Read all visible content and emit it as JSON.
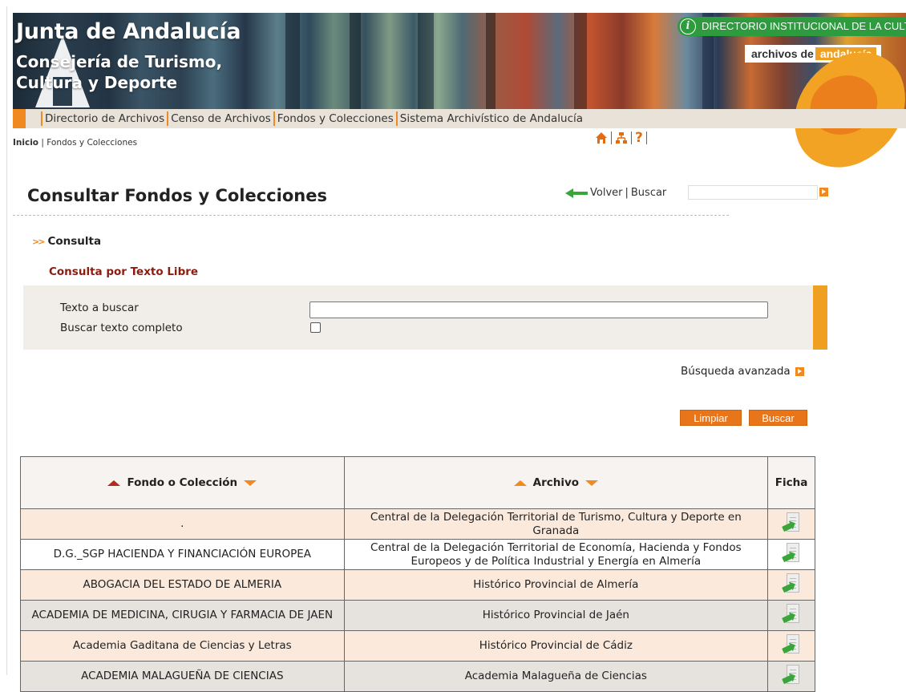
{
  "banner": {
    "title": "Junta de Andalucía",
    "subtitle_line1": "Consejería de Turismo,",
    "subtitle_line2": "Cultura y Deporte",
    "directory_link": "DIRECTORIO INSTITUCIONAL DE LA CULTURA",
    "brand_prefix": "archivos de",
    "brand_highlight": "andalucía"
  },
  "menu": {
    "items": [
      "Directorio de Archivos",
      "Censo de Archivos",
      "Fondos y Colecciones",
      "Sistema Archivístico de Andalucía"
    ]
  },
  "breadcrumb": {
    "home": "Inicio",
    "separator": "|",
    "current": "Fondos y Colecciones"
  },
  "util": {
    "help_label": "?"
  },
  "header": {
    "title": "Consultar Fondos y Colecciones",
    "back_label": "Volver",
    "separator": "|",
    "search_label": "Buscar",
    "search_value": ""
  },
  "section": {
    "title": "Consulta",
    "subtitle": "Consulta por Texto Libre"
  },
  "form": {
    "text_label": "Texto a buscar",
    "text_value": "",
    "full_text_label": "Buscar texto completo",
    "full_text_checked": false
  },
  "advanced_search_label": "Búsqueda avanzada",
  "buttons": {
    "clear": "Limpiar",
    "search": "Buscar"
  },
  "table": {
    "headers": {
      "fondo": "Fondo o Colección",
      "archivo": "Archivo",
      "ficha": "Ficha"
    },
    "rows": [
      {
        "fondo": ".",
        "archivo": "Central de la Delegación Territorial de Turismo, Cultura y Deporte en Granada"
      },
      {
        "fondo": "D.G._SGP HACIENDA Y FINANCIACIÓN EUROPEA",
        "archivo": "Central de la Delegación Territorial de Economía, Hacienda y Fondos Europeos y de Política Industrial y Energía en Almería"
      },
      {
        "fondo": "ABOGACIA DEL ESTADO DE ALMERIA",
        "archivo": "Histórico Provincial de Almería"
      },
      {
        "fondo": "ACADEMIA DE MEDICINA, CIRUGIA Y FARMACIA DE JAEN",
        "archivo": "Histórico Provincial de Jaén"
      },
      {
        "fondo": "Academia Gaditana de Ciencias y Letras",
        "archivo": "Histórico Provincial de Cádiz"
      },
      {
        "fondo": "ACADEMIA MALAGUEÑA DE CIENCIAS",
        "archivo": "Academia Malagueña de Ciencias"
      }
    ]
  },
  "colors": {
    "accent_orange": "#f08a20",
    "heading_red": "#8a1c10",
    "brand_green": "#2e9b3e"
  }
}
